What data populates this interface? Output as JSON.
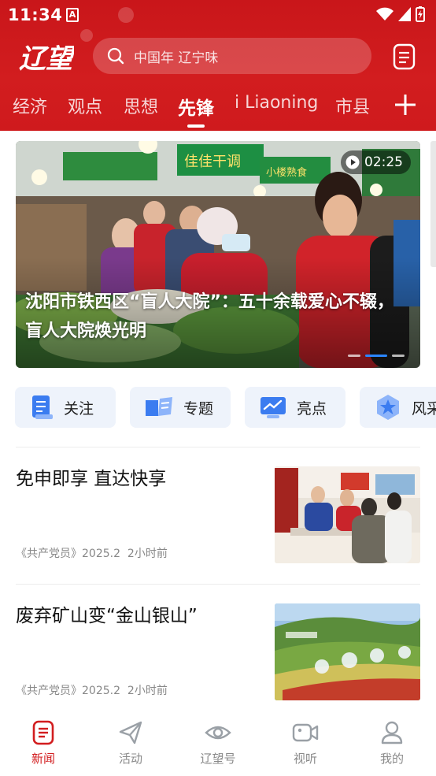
{
  "status_bar": {
    "time": "11:34",
    "app_badge": "A"
  },
  "header": {
    "logo_text": "辽望",
    "search_placeholder": "中国年 辽宁味",
    "accent_color": "#d21d1f"
  },
  "tabs": [
    {
      "label": "经济",
      "active": false
    },
    {
      "label": "观点",
      "active": false
    },
    {
      "label": "思想",
      "active": false
    },
    {
      "label": "先锋",
      "active": true
    },
    {
      "label": "i Liaoning",
      "active": false
    },
    {
      "label": "市县",
      "active": false
    }
  ],
  "hero": {
    "duration": "02:25",
    "caption": "沈阳市铁西区“盲人大院”：五十余载爱心不辍，盲人大院焕光明",
    "sign1": "佳佳干调",
    "sign2": "小楼熟食"
  },
  "quick_entries": [
    {
      "label": "关注",
      "icon": "document-icon"
    },
    {
      "label": "专题",
      "icon": "open-book-icon"
    },
    {
      "label": "亮点",
      "icon": "chart-monitor-icon"
    },
    {
      "label": "风采",
      "icon": "star-badge-icon"
    }
  ],
  "news": [
    {
      "title": "免申即享 直达快享",
      "source": "《共产党员》2025.2",
      "time": "2小时前"
    },
    {
      "title": "废弃矿山变“金山银山”",
      "source": "《共产党员》2025.2",
      "time": "2小时前"
    }
  ],
  "bottom_nav": [
    {
      "label": "新闻",
      "icon": "news-icon",
      "active": true
    },
    {
      "label": "活动",
      "icon": "paper-plane-icon",
      "active": false
    },
    {
      "label": "辽望号",
      "icon": "eye-icon",
      "active": false
    },
    {
      "label": "视听",
      "icon": "video-camera-icon",
      "active": false
    },
    {
      "label": "我的",
      "icon": "user-icon",
      "active": false
    }
  ]
}
